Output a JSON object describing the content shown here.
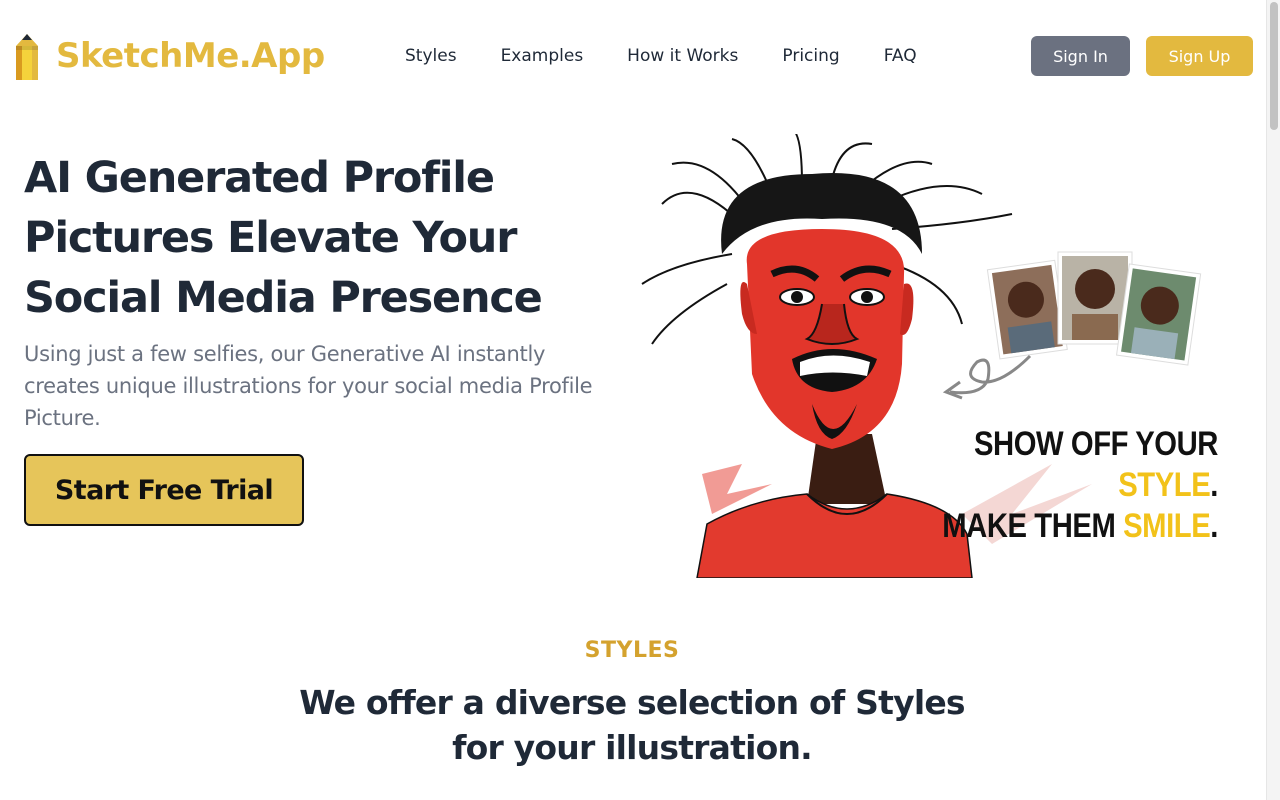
{
  "brand": {
    "name": "SketchMe.App",
    "color": "#e3b93f"
  },
  "nav": {
    "items": [
      {
        "label": "Styles"
      },
      {
        "label": "Examples"
      },
      {
        "label": "How it Works"
      },
      {
        "label": "Pricing"
      },
      {
        "label": "FAQ"
      }
    ]
  },
  "auth": {
    "sign_in_label": "Sign In",
    "sign_up_label": "Sign Up"
  },
  "hero": {
    "title": "AI Generated Profile Pictures Elevate Your Social Media Presence",
    "subtitle": "Using just a few selfies, our Generative AI instantly creates unique illustrations for your social media Profile Picture.",
    "cta_label": "Start Free Trial",
    "image": {
      "slogan_line1_prefix": "SHOW OFF YOUR ",
      "slogan_line1_highlight": "STYLE",
      "slogan_line2_prefix": "MAKE THEM ",
      "slogan_line2_highlight": "SMILE",
      "slogan_terminator": "."
    }
  },
  "styles_section": {
    "eyebrow": "STYLES",
    "title": "We offer a diverse selection of Styles for your illustration."
  },
  "colors": {
    "accent": "#e3b93f",
    "heading": "#1f2937",
    "muted": "#6b7280",
    "sign_in_bg": "#6b7180",
    "slogan_highlight": "#f2c21a"
  }
}
